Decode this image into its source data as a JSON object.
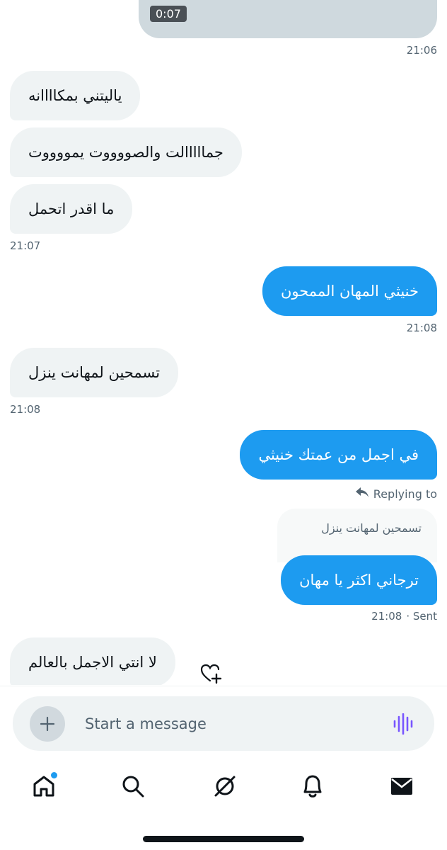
{
  "media": {
    "duration": "0:07"
  },
  "messages": [
    {
      "id": 1,
      "text": "ياليتني بمكاااانه"
    },
    {
      "id": 2,
      "text": "جمااااالت والصووووت يمووووت"
    },
    {
      "id": 3,
      "text": "ما اقدر اتحمل"
    },
    {
      "id": 4,
      "text": "خنيثي المهان الممحون"
    },
    {
      "id": 5,
      "text": "تسمحين لمهانت ينزل"
    },
    {
      "id": 6,
      "text": "في اجمل من عمتك خنيثي"
    },
    {
      "id": 7,
      "text": "ترجاني اكثر يا مهان"
    },
    {
      "id": 8,
      "text": "لا انتي الاجمل بالعالم"
    }
  ],
  "timestamps": {
    "t1": "21:06",
    "t2": "21:07",
    "t3": "21:08",
    "t4": "21:08",
    "t5": "21:08"
  },
  "reply": {
    "label": "Replying to",
    "quoted": "تسمحين لمهانت ينزل"
  },
  "sent_status": {
    "time": "21:08",
    "status": "· Sent"
  },
  "composer": {
    "placeholder": "Start a message"
  },
  "nav": {
    "items": [
      "home-icon",
      "search-icon",
      "grok-icon",
      "notifications-icon",
      "messages-icon"
    ],
    "notification_dot_color": "#1d9bf0"
  },
  "colors": {
    "accent": "#1d9bf0",
    "bubble_in": "#eff3f4",
    "muted": "#536471",
    "voice": "#7856ff"
  }
}
